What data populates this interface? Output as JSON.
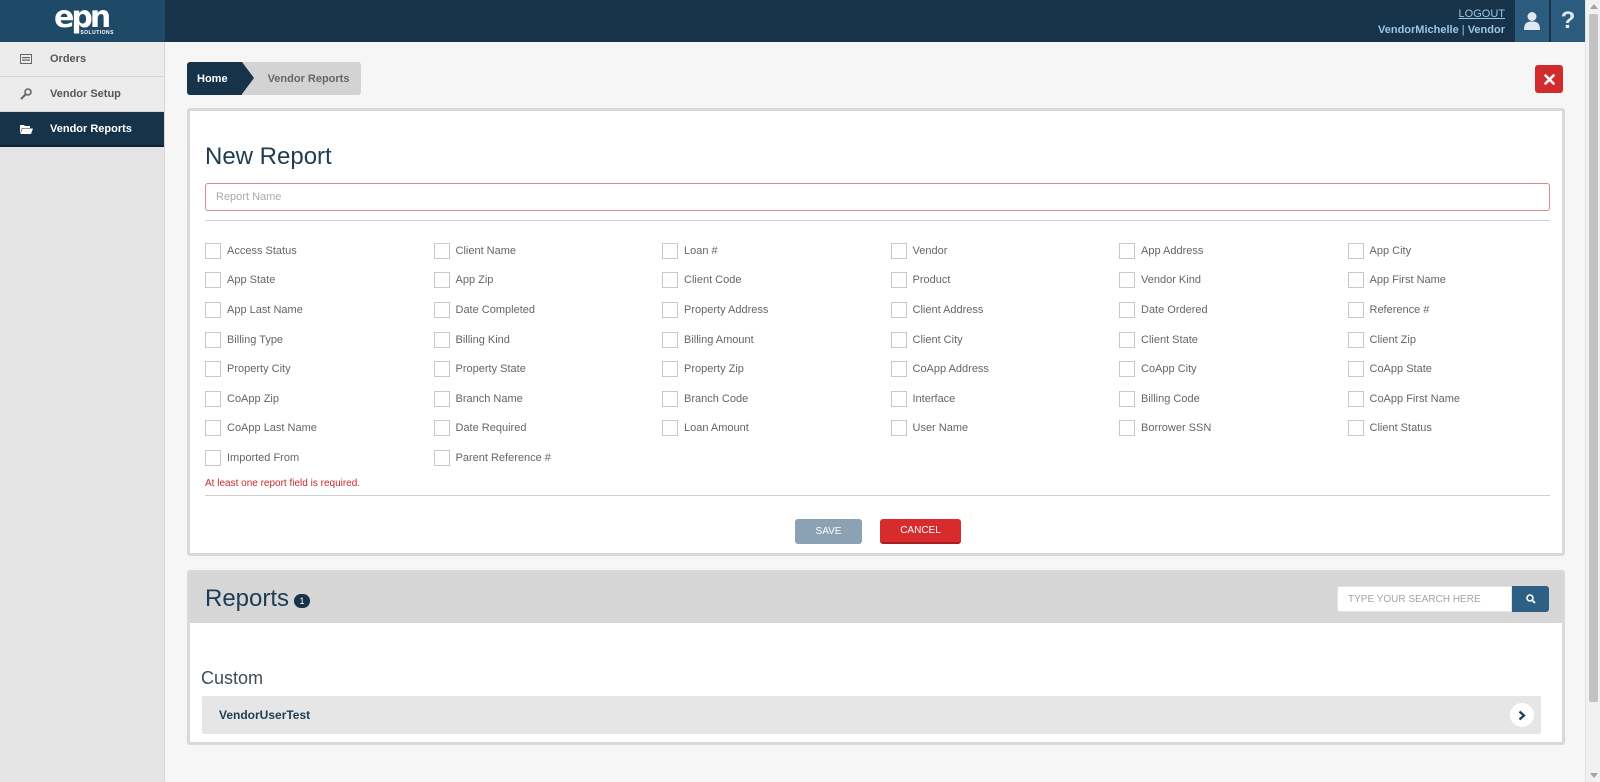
{
  "header": {
    "logo_text": "epn",
    "logo_sub": "SOLUTIONS",
    "logout": "LOGOUT",
    "username": "VendorMichelle",
    "separator": "|",
    "role": "Vendor",
    "help_glyph": "?"
  },
  "sidebar": {
    "items": [
      {
        "label": "Orders",
        "icon": "orders-icon"
      },
      {
        "label": "Vendor Setup",
        "icon": "wrench-icon"
      },
      {
        "label": "Vendor Reports",
        "icon": "folder-open-icon",
        "active": true
      }
    ]
  },
  "breadcrumb": {
    "home": "Home",
    "current": "Vendor Reports"
  },
  "new_report": {
    "title": "New Report",
    "name_placeholder": "Report Name",
    "fields": [
      "Access Status",
      "Client Name",
      "Loan #",
      "Vendor",
      "App Address",
      "App City",
      "App State",
      "App Zip",
      "Client Code",
      "Product",
      "Vendor Kind",
      "App First Name",
      "App Last Name",
      "Date Completed",
      "Property Address",
      "Client Address",
      "Date Ordered",
      "Reference #",
      "Billing Type",
      "Billing Kind",
      "Billing Amount",
      "Client City",
      "Client State",
      "Client Zip",
      "Property City",
      "Property State",
      "Property Zip",
      "CoApp Address",
      "CoApp City",
      "CoApp State",
      "CoApp Zip",
      "Branch Name",
      "Branch Code",
      "Interface",
      "Billing Code",
      "CoApp First Name",
      "CoApp Last Name",
      "Date Required",
      "Loan Amount",
      "User Name",
      "Borrower SSN",
      "Client Status",
      "Imported From",
      "Parent Reference #"
    ],
    "error": "At least one report field is required.",
    "save_label": "SAVE",
    "cancel_label": "CANCEL"
  },
  "reports": {
    "title": "Reports",
    "count": "1",
    "search_placeholder": "TYPE YOUR SEARCH HERE",
    "section": "Custom",
    "items": [
      {
        "name": "VendorUserTest"
      }
    ]
  },
  "colors": {
    "navy": "#173349",
    "danger": "#d72b2e",
    "accent": "#2e5f84"
  }
}
